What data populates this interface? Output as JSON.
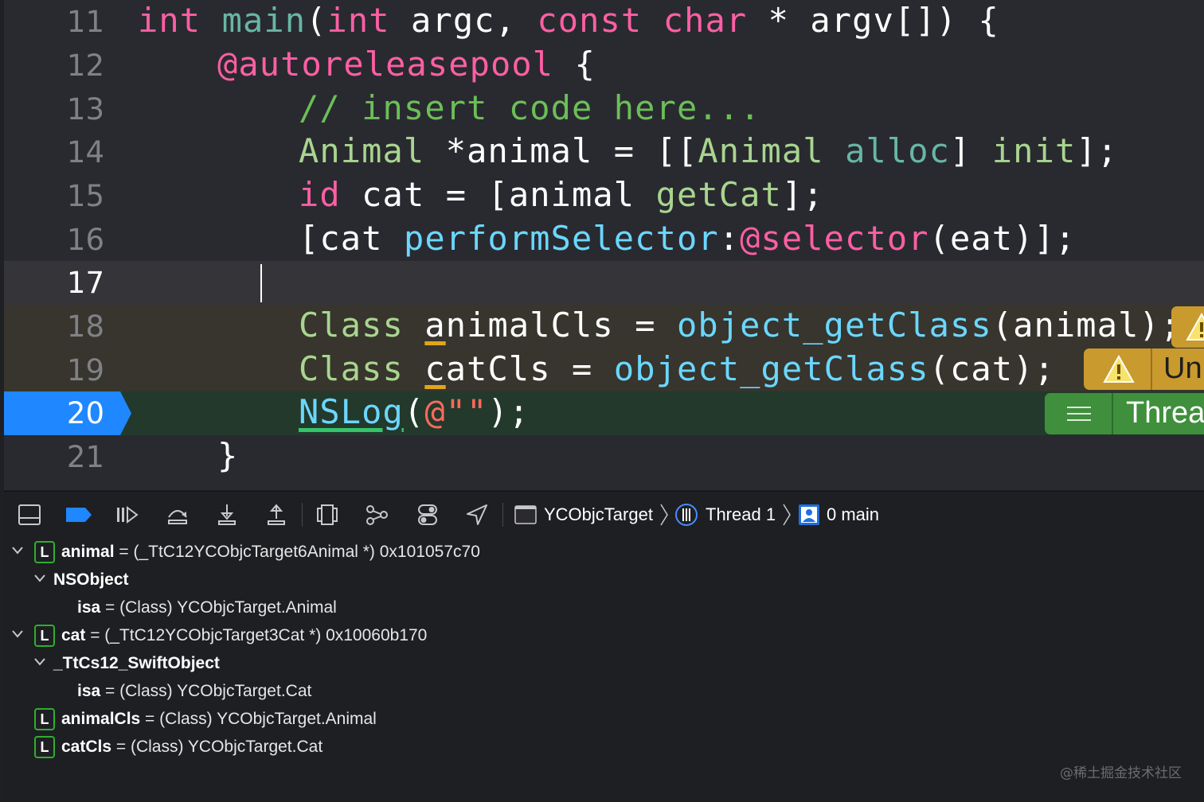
{
  "editor": {
    "lines": [
      {
        "n": "11",
        "state": "normal"
      },
      {
        "n": "12",
        "state": "normal"
      },
      {
        "n": "13",
        "state": "normal"
      },
      {
        "n": "14",
        "state": "normal"
      },
      {
        "n": "15",
        "state": "normal"
      },
      {
        "n": "16",
        "state": "normal"
      },
      {
        "n": "17",
        "state": "current"
      },
      {
        "n": "18",
        "state": "warning"
      },
      {
        "n": "19",
        "state": "warning"
      },
      {
        "n": "20",
        "state": "program-counter"
      },
      {
        "n": "21",
        "state": "normal"
      }
    ],
    "code": {
      "l11": [
        "int",
        " ",
        "main",
        "(",
        "int",
        " argc, ",
        "const",
        " ",
        "char",
        " * argv[]) {"
      ],
      "l12": [
        "@autoreleasepool",
        " {"
      ],
      "l13": [
        "// insert code here..."
      ],
      "l14": [
        "Animal",
        " *animal = [[",
        "Animal",
        " ",
        "alloc",
        "] ",
        "init",
        "];"
      ],
      "l15": [
        "id",
        " cat = [animal ",
        "getCat",
        "];"
      ],
      "l16": [
        "[cat ",
        "performSelector",
        ":",
        "@selector",
        "(eat)];"
      ],
      "l18": [
        "Class",
        " ",
        "a",
        "nimalCls = ",
        "object_getClass",
        "(animal);"
      ],
      "l19": [
        "Class",
        " ",
        "c",
        "atCls = ",
        "object_getClass",
        "(cat);"
      ],
      "l20": [
        "NSLog",
        "(",
        "@\"\"",
        ");"
      ],
      "l21": [
        "}"
      ]
    },
    "badges": {
      "warn2_text": "Un",
      "thread_text": "Threa"
    },
    "colors": {
      "keyword": "#fc5fa3",
      "comment": "#6bbf57",
      "type": "#a9d58f",
      "project_func": "#6bd7ff",
      "string": "#fc6a5d",
      "pc_arrow": "#1f87ff",
      "warning": "#c99a2e",
      "thread_badge": "#3f8f3d"
    }
  },
  "debug_bar": {
    "buttons": [
      "hide-debug-area",
      "breakpoints-toggle",
      "continue",
      "step-over",
      "step-into",
      "step-out",
      "view-hierarchy",
      "memory-graph",
      "environment-overrides",
      "simulate-location"
    ],
    "breadcrumb": {
      "target": "YCObjcTarget",
      "thread": "Thread 1",
      "frame": "0 main"
    }
  },
  "variables": [
    {
      "indent": 0,
      "expand": true,
      "badge": "L",
      "name": "animal",
      "eq": " = ",
      "type": "(_TtC12YCObjcTarget6Animal *)",
      "value": " 0x101057c70"
    },
    {
      "indent": 1,
      "expand": true,
      "badge": "",
      "name": "NSObject",
      "eq": "",
      "type": "",
      "value": ""
    },
    {
      "indent": 2,
      "expand": false,
      "badge": "",
      "name": "isa",
      "eq": " = ",
      "type": "(Class)",
      "value": " YCObjcTarget.Animal"
    },
    {
      "indent": 0,
      "expand": true,
      "badge": "L",
      "name": "cat",
      "eq": " = ",
      "type": "(_TtC12YCObjcTarget3Cat *)",
      "value": " 0x10060b170"
    },
    {
      "indent": 1,
      "expand": true,
      "badge": "",
      "name": "_TtCs12_SwiftObject",
      "eq": "",
      "type": "",
      "value": ""
    },
    {
      "indent": 2,
      "expand": false,
      "badge": "",
      "name": "isa",
      "eq": " = ",
      "type": "(Class)",
      "value": " YCObjcTarget.Cat"
    },
    {
      "indent": 0,
      "expand": false,
      "badge": "L",
      "name": "animalCls",
      "eq": " = ",
      "type": "(Class)",
      "value": " YCObjcTarget.Animal"
    },
    {
      "indent": 0,
      "expand": false,
      "badge": "L",
      "name": "catCls",
      "eq": " = ",
      "type": "(Class)",
      "value": " YCObjcTarget.Cat"
    }
  ],
  "watermark": "@稀土掘金技术社区"
}
